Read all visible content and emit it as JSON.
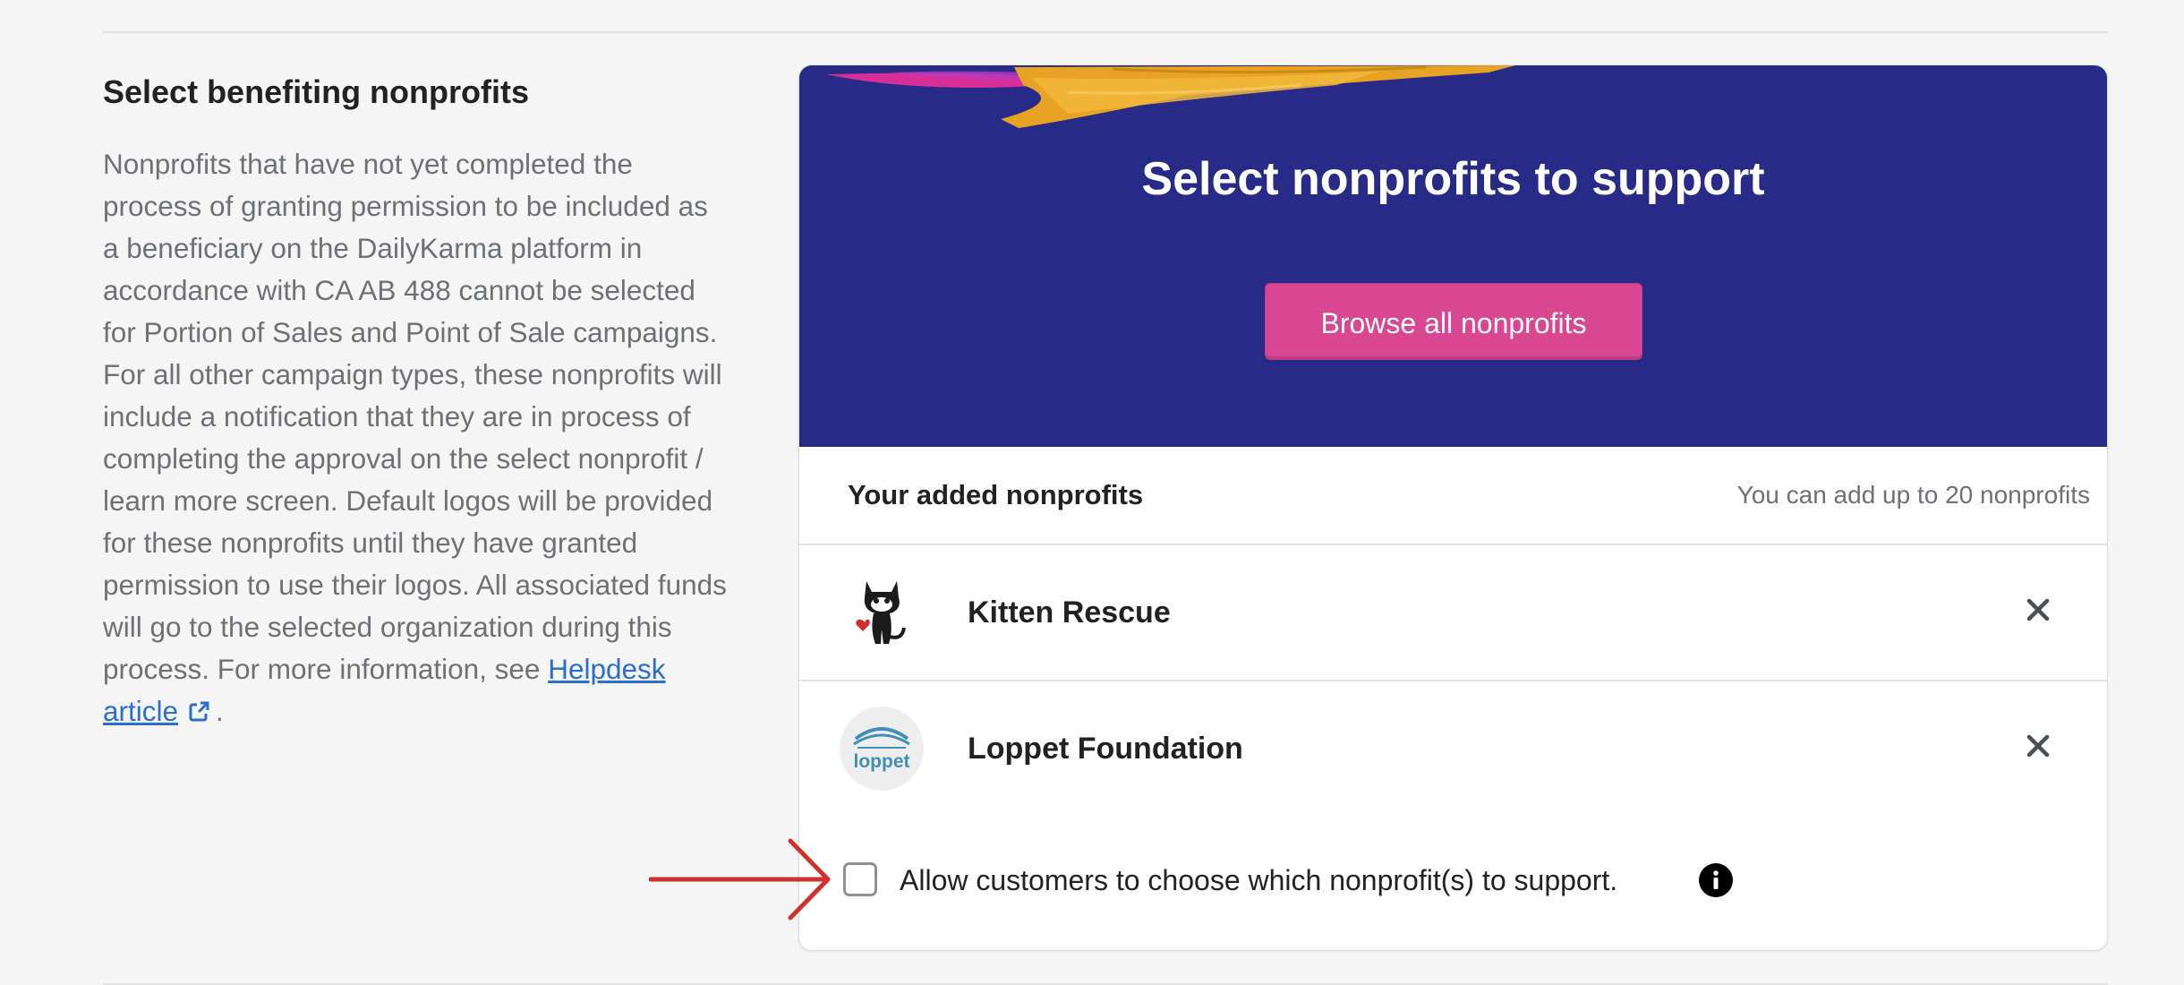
{
  "left_panel": {
    "heading": "Select benefiting nonprofits",
    "description": "Nonprofits that have not yet completed the process of granting permission to be included as a beneficiary on the DailyKarma platform in accordance with CA AB 488 cannot be selected for Portion of Sales and Point of Sale campaigns. For all other campaign types, these nonprofits will include a notification that they are in process of completing the approval on the select nonprofit / learn more screen. Default logos will be provided for these nonprofits until they have granted permission to use their logos. All associated funds will go to the selected organization during this process. For more information, see",
    "link_text_line1": "Helpdesk",
    "link_text_line2": "article",
    "trailing": ".",
    "link_icon": "external-link-icon"
  },
  "banner": {
    "title": "Select nonprofits to support",
    "browse_button": "Browse all nonprofits"
  },
  "list": {
    "header_title": "Your added nonprofits",
    "limit_text": "You can add up to 20 nonprofits",
    "items": [
      {
        "name": "Kitten Rescue",
        "logo": "kitten-rescue-logo"
      },
      {
        "name": "Loppet Foundation",
        "logo": "loppet-logo"
      }
    ],
    "loppet_logo_text": "loppet"
  },
  "choice": {
    "label": "Allow customers to choose which nonprofit(s) to support.",
    "checked": false
  },
  "colors": {
    "banner": "#272a86",
    "button": "#d94691",
    "link": "#2c6ecb",
    "annotation_arrow": "#d0312d"
  }
}
